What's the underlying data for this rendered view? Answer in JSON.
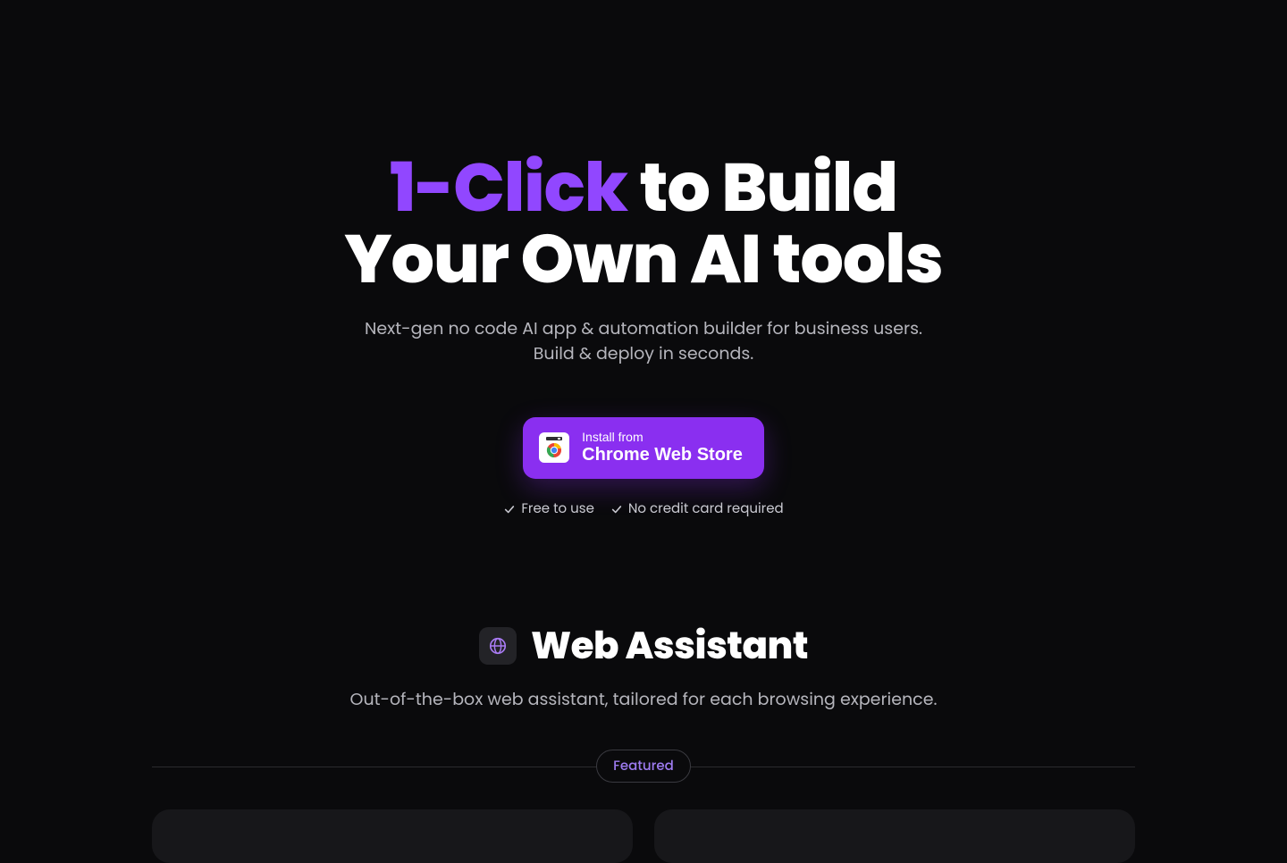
{
  "hero": {
    "title_accent": "1-Click",
    "title_rest_line1": " to Build",
    "title_rest_line2": "Your Own AI tools",
    "subtitle_line1": "Next-gen no code AI app & automation builder for business users.",
    "subtitle_line2": "Build & deploy in seconds."
  },
  "install_button": {
    "small": "Install from",
    "big": "Chrome Web Store"
  },
  "benefits": [
    "Free to use",
    "No credit card required"
  ],
  "section2": {
    "title": "Web Assistant",
    "subtitle": "Out-of-the-box web assistant, tailored for each browsing experience.",
    "featured_label": "Featured"
  }
}
